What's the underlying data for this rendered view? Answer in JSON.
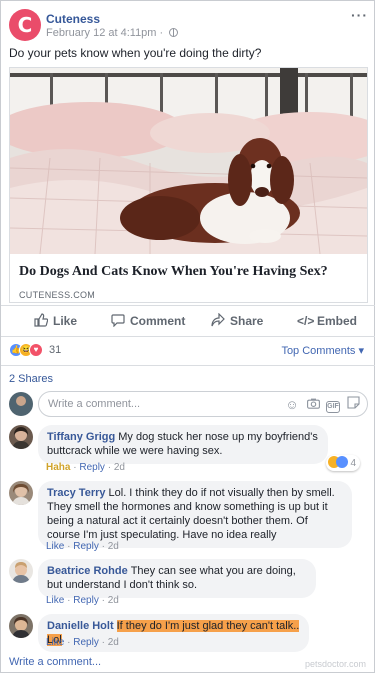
{
  "post": {
    "page_name": "Cuteness",
    "logo_letter": "C",
    "timestamp": "February 12 at 4:11pm",
    "meta_separator": " · ",
    "text": "Do your pets know when you're doing the dirty?",
    "more_icon": "more-options-icon"
  },
  "link": {
    "title": "Do Dogs And Cats Know When You're Having Sex?",
    "domain": "CUTENESS.COM"
  },
  "actions": {
    "like": "Like",
    "comment": "Comment",
    "share": "Share",
    "embed": "Embed"
  },
  "reactions": {
    "types": [
      "like-icon",
      "haha-icon",
      "love-icon"
    ],
    "count": "31",
    "sort_label": "Top Comments ▾"
  },
  "shares": "2 Shares",
  "composer": {
    "placeholder": "Write a comment...",
    "icons": [
      "emoji-icon",
      "camera-icon",
      "gif-icon",
      "sticker-icon"
    ]
  },
  "comments": [
    {
      "author": "Tiffany Grigg",
      "text": "My dog stuck her nose up my boyfriend's buttcrack while we were having sex.",
      "reaction_label": "Haha",
      "reply": "Reply",
      "time": "2d",
      "reaction_count": "4"
    },
    {
      "author": "Tracy Terry",
      "text": "Lol. I think they do if not visually then by smell. They smell the hormones and know something is up but it being a natural act it certainly doesn't bother them. Of course I'm just speculating. Have no idea really",
      "like": "Like",
      "reply": "Reply",
      "time": "2d"
    },
    {
      "author": "Beatrice Rohde",
      "text": "They can see what you are doing, but understand I don't think so.",
      "like": "Like",
      "reply": "Reply",
      "time": "2d"
    },
    {
      "author": "Danielle Holt",
      "text": "If they do I'm just glad they can't talk.. Lol",
      "like": "Like",
      "reply": "Reply",
      "time": "2d"
    }
  ],
  "write_comment": "Write a comment...",
  "watermark": "petsdoctor.com",
  "colors": {
    "brand_logo": "#ea4c6a",
    "link_blue": "#365899",
    "highlight": "#f6a04a"
  }
}
